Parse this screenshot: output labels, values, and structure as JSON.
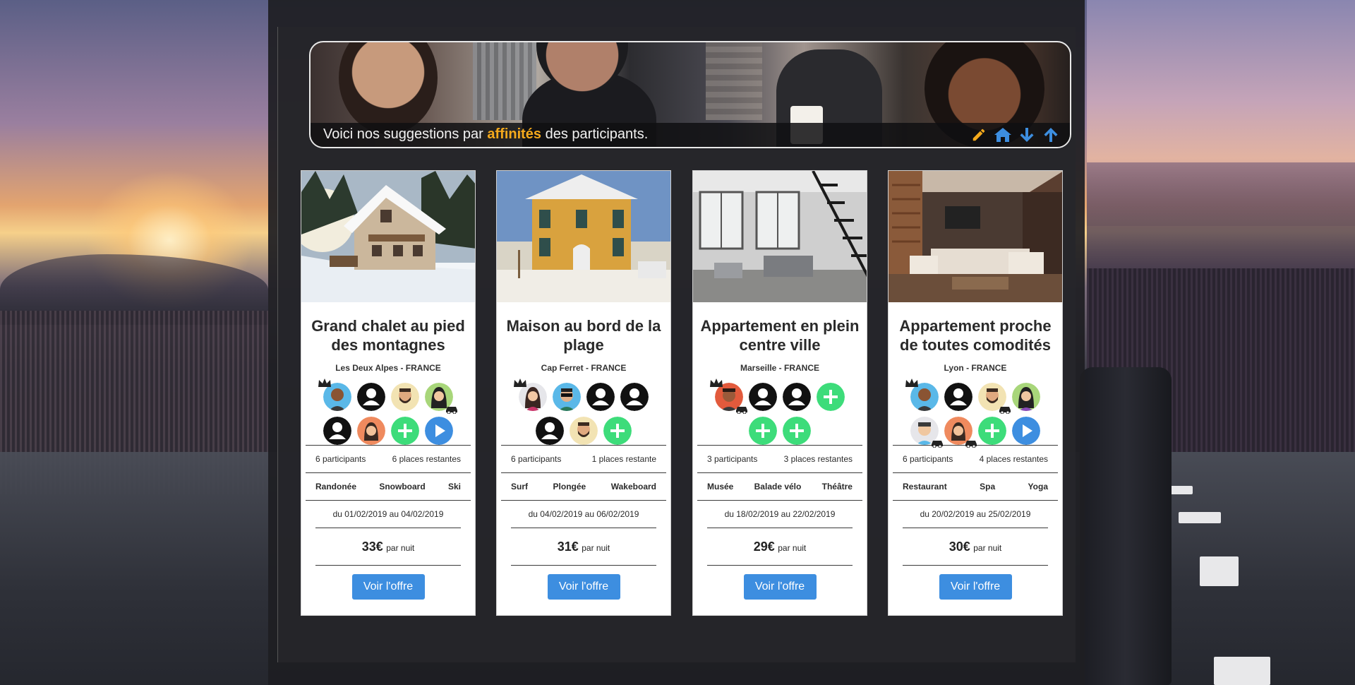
{
  "banner": {
    "text_before": "Voici nos suggestions par ",
    "text_highlight": "affinités",
    "text_after": " des participants.",
    "icons": [
      "pencil-icon",
      "home-icon",
      "arrow-down-icon",
      "arrow-up-icon"
    ],
    "highlight_color": "#f4a91c",
    "icon_color": "#3d8ee0"
  },
  "cards": [
    {
      "title": "Grand chalet au pied des montagnes",
      "location": "Les Deux Alpes - FRANCE",
      "participants": "6 participants",
      "places": "6 places restantes",
      "activities": [
        "Randonée",
        "Snowboard",
        "Ski"
      ],
      "dates": "du 01/02/2019 au 04/02/2019",
      "price": "33€",
      "price_unit": "par nuit",
      "button": "Voir l'offre"
    },
    {
      "title": "Maison au bord de la plage",
      "location": "Cap Ferret - FRANCE",
      "participants": "6 participants",
      "places": "1 places restante",
      "activities": [
        "Surf",
        "Plongée",
        "Wakeboard"
      ],
      "dates": "du 04/02/2019 au 06/02/2019",
      "price": "31€",
      "price_unit": "par nuit",
      "button": "Voir l'offre"
    },
    {
      "title": "Appartement en plein centre ville",
      "location": "Marseille - FRANCE",
      "participants": "3 participants",
      "places": "3 places restantes",
      "activities": [
        "Musée",
        "Balade vélo",
        "Théâtre"
      ],
      "dates": "du 18/02/2019 au 22/02/2019",
      "price": "29€",
      "price_unit": "par nuit",
      "button": "Voir l'offre"
    },
    {
      "title": "Appartement proche de toutes comodités",
      "location": "Lyon - FRANCE",
      "participants": "6 participants",
      "places": "4 places restantes",
      "activities": [
        "Restaurant",
        "Spa",
        "Yoga"
      ],
      "dates": "du 20/02/2019 au 25/02/2019",
      "price": "30€",
      "price_unit": "par nuit",
      "button": "Voir l'offre"
    }
  ],
  "colors": {
    "button": "#3d8ee0",
    "add": "#3ddc7a",
    "play": "#3d8ee0"
  }
}
